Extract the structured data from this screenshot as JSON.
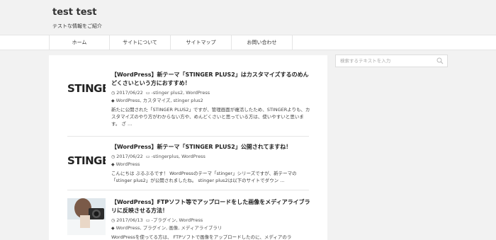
{
  "site": {
    "title": "test test",
    "description": "テストな情報をご紹介"
  },
  "nav": {
    "items": [
      {
        "label": "ホーム"
      },
      {
        "label": "サイトについて"
      },
      {
        "label": "サイトマップ"
      },
      {
        "label": "お問い合わせ"
      }
    ]
  },
  "search": {
    "placeholder": "検索するテキストを入力"
  },
  "posts": [
    {
      "thumb_text": "STINGER",
      "title": "【WordPress】新テーマ「STINGER PLUS2」はカスタマイズするのめんどくさいという方におすすめ！",
      "date": "2017/06/22",
      "categories": "-stinger plus2, WordPress",
      "tags": "WordPress, カスタマイズ, stinger plus2",
      "excerpt": "新たに公開された「STINGER PLUS2」ですが、管理画面が複活したため、STINGERよりも、カスタマイズのやり方がわからない方や、めんどくさいと思っている方は、使いやすいと思います。 ざ …"
    },
    {
      "thumb_text": "STINGER",
      "title": "【WordPress】新テーマ「STINGER PLUS2」公開されてますね！",
      "date": "2017/06/22",
      "categories": "-stingerplus, WordPress",
      "tags": "WordPress",
      "excerpt": "こんにちは ぶるぶるです！ WordPressのテーマ「stinger」シリーズですが、新テーマの「stinger plus2」が公開されましたね。 stinger plus2は以下のサイトでダウン …"
    },
    {
      "thumb_text": "",
      "title": "【WordPress】FTPソフト等でアップロードをした画像をメディアライブラリに反映させる方法！",
      "date": "2017/06/13",
      "categories": "-プラグイン, WordPress",
      "tags": "WordPress, プラグイン, 画像, メディアライブラリ",
      "excerpt": "WordPressを使ってる方は、 FTPソフトで画像をアップロードしたのに、メディアのラ"
    }
  ],
  "icons": {
    "clock": "clock-icon",
    "folder": "folder-icon",
    "tag": "tag-icon",
    "search": "search-icon",
    "camera": "camera-icon"
  }
}
